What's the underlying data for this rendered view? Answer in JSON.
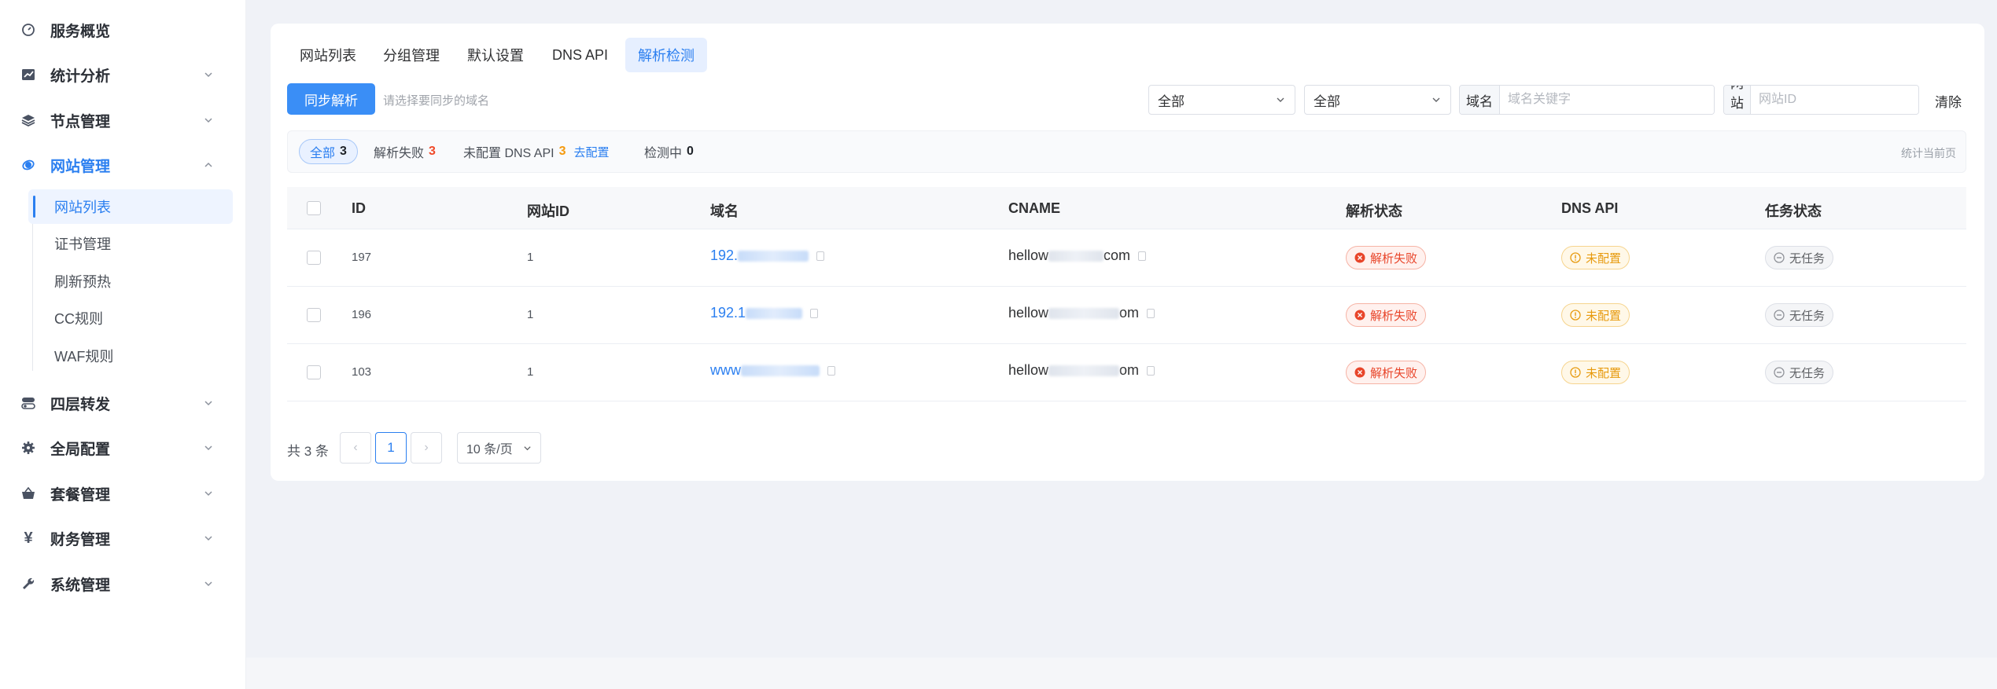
{
  "sidebar": {
    "items": [
      {
        "label": "服务概览",
        "icon": "dashboard-icon",
        "expandable": false
      },
      {
        "label": "统计分析",
        "icon": "chart-icon",
        "expandable": true
      },
      {
        "label": "节点管理",
        "icon": "layers-icon",
        "expandable": true
      },
      {
        "label": "网站管理",
        "icon": "globe-icon",
        "expandable": true,
        "active": true
      },
      {
        "label": "四层转发",
        "icon": "toggle-icon",
        "expandable": true
      },
      {
        "label": "全局配置",
        "icon": "gear-icon",
        "expandable": true
      },
      {
        "label": "套餐管理",
        "icon": "basket-icon",
        "expandable": true
      },
      {
        "label": "财务管理",
        "icon": "yen-icon",
        "expandable": true
      },
      {
        "label": "系统管理",
        "icon": "wrench-icon",
        "expandable": true
      }
    ],
    "sub_items": [
      {
        "label": "网站列表",
        "active": true
      },
      {
        "label": "证书管理"
      },
      {
        "label": "刷新预热"
      },
      {
        "label": "CC规则"
      },
      {
        "label": "WAF规则"
      }
    ]
  },
  "tabs": [
    {
      "label": "网站列表"
    },
    {
      "label": "分组管理"
    },
    {
      "label": "默认设置"
    },
    {
      "label": "DNS API"
    },
    {
      "label": "解析检测",
      "active": true
    }
  ],
  "toolbar": {
    "sync_label": "同步解析",
    "sync_hint": "请选择要同步的域名",
    "select1_value": "全部",
    "select2_value": "全部",
    "domain_prefix": "域名",
    "domain_placeholder": "域名关键字",
    "siteid_prefix": "网站ID",
    "siteid_placeholder": "网站ID",
    "clear_label": "清除"
  },
  "filters": {
    "all_label": "全部",
    "all_count": "3",
    "fail_label": "解析失败",
    "fail_count": "3",
    "nodns_label": "未配置 DNS API",
    "nodns_count": "3",
    "nodns_link": "去配置",
    "checking_label": "检测中",
    "checking_count": "0",
    "note": "统计当前页"
  },
  "table": {
    "headers": {
      "id": "ID",
      "site_id": "网站ID",
      "domain": "域名",
      "cname": "CNAME",
      "resolve": "解析状态",
      "dns_api": "DNS API",
      "task": "任务状态"
    },
    "rows": [
      {
        "id": "197",
        "site_id": "1",
        "domain_prefix": "192.",
        "cname_prefix": "hellow",
        "cname_suffix": "com",
        "resolve": "解析失败",
        "dns_api": "未配置",
        "task": "无任务"
      },
      {
        "id": "196",
        "site_id": "1",
        "domain_prefix": "192.1",
        "cname_prefix": "hellow",
        "cname_suffix": "om",
        "resolve": "解析失败",
        "dns_api": "未配置",
        "task": "无任务"
      },
      {
        "id": "103",
        "site_id": "1",
        "domain_prefix": "www",
        "cname_prefix": "hellow",
        "cname_suffix": "om",
        "resolve": "解析失败",
        "dns_api": "未配置",
        "task": "无任务"
      }
    ]
  },
  "pagination": {
    "total": "共 3 条",
    "prev": "‹",
    "page": "1",
    "next": "›",
    "page_size": "10 条/页"
  },
  "colors": {
    "accent": "#2b7ff0",
    "danger": "#e8452a",
    "warning": "#e79a0e"
  }
}
